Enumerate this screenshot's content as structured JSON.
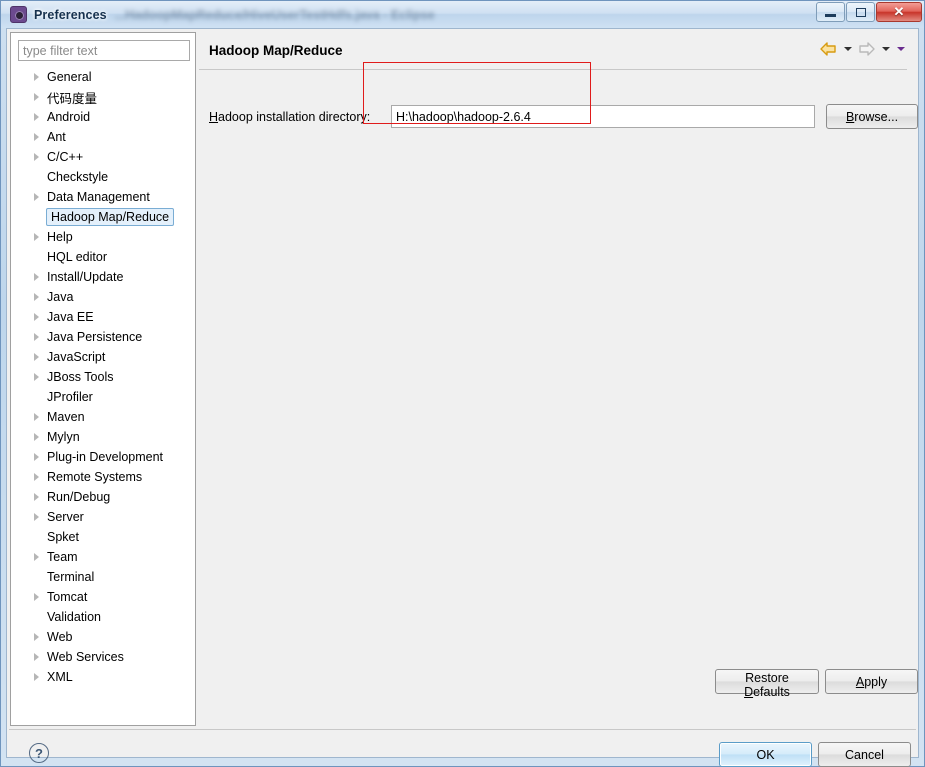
{
  "window": {
    "title": "Preferences",
    "background_title": "...HadoopMapReduce/HiveUserTestHdfs.java - Eclipse",
    "icon": "gear-icon",
    "buttons": {
      "minimize": "minimize-icon",
      "restore": "restore-icon",
      "close": "close-icon"
    }
  },
  "sidebar": {
    "filter_placeholder": "type filter text",
    "filter_value": "",
    "items": [
      {
        "label": "General",
        "expandable": true,
        "selected": false
      },
      {
        "label": "代码度量",
        "expandable": true,
        "selected": false
      },
      {
        "label": "Android",
        "expandable": true,
        "selected": false
      },
      {
        "label": "Ant",
        "expandable": true,
        "selected": false
      },
      {
        "label": "C/C++",
        "expandable": true,
        "selected": false
      },
      {
        "label": "Checkstyle",
        "expandable": false,
        "selected": false
      },
      {
        "label": "Data Management",
        "expandable": true,
        "selected": false
      },
      {
        "label": "Hadoop Map/Reduce",
        "expandable": false,
        "selected": true
      },
      {
        "label": "Help",
        "expandable": true,
        "selected": false
      },
      {
        "label": "HQL editor",
        "expandable": false,
        "selected": false
      },
      {
        "label": "Install/Update",
        "expandable": true,
        "selected": false
      },
      {
        "label": "Java",
        "expandable": true,
        "selected": false
      },
      {
        "label": "Java EE",
        "expandable": true,
        "selected": false
      },
      {
        "label": "Java Persistence",
        "expandable": true,
        "selected": false
      },
      {
        "label": "JavaScript",
        "expandable": true,
        "selected": false
      },
      {
        "label": "JBoss Tools",
        "expandable": true,
        "selected": false
      },
      {
        "label": "JProfiler",
        "expandable": false,
        "selected": false
      },
      {
        "label": "Maven",
        "expandable": true,
        "selected": false
      },
      {
        "label": "Mylyn",
        "expandable": true,
        "selected": false
      },
      {
        "label": "Plug-in Development",
        "expandable": true,
        "selected": false
      },
      {
        "label": "Remote Systems",
        "expandable": true,
        "selected": false
      },
      {
        "label": "Run/Debug",
        "expandable": true,
        "selected": false
      },
      {
        "label": "Server",
        "expandable": true,
        "selected": false
      },
      {
        "label": "Spket",
        "expandable": false,
        "selected": false
      },
      {
        "label": "Team",
        "expandable": true,
        "selected": false
      },
      {
        "label": "Terminal",
        "expandable": false,
        "selected": false
      },
      {
        "label": "Tomcat",
        "expandable": true,
        "selected": false
      },
      {
        "label": "Validation",
        "expandable": false,
        "selected": false
      },
      {
        "label": "Web",
        "expandable": true,
        "selected": false
      },
      {
        "label": "Web Services",
        "expandable": true,
        "selected": false
      },
      {
        "label": "XML",
        "expandable": true,
        "selected": false
      }
    ]
  },
  "page": {
    "title": "Hadoop Map/Reduce",
    "field_label_mnemonic": "H",
    "field_label_rest": "adoop installation directory:",
    "field_value": "H:\\hadoop\\hadoop-2.6.4",
    "browse_mnemonic": "B",
    "browse_rest": "rowse...",
    "restore_defaults_pre": "Restore ",
    "restore_defaults_mnemonic": "D",
    "restore_defaults_rest": "efaults",
    "apply_mnemonic": "A",
    "apply_rest": "pply",
    "nav": {
      "back": "back-arrow-icon",
      "back_menu": "chevron-down-icon",
      "forward": "forward-arrow-icon",
      "forward_menu": "chevron-down-icon",
      "view_menu": "chevron-down-icon"
    }
  },
  "footer": {
    "help": "?",
    "ok_label": "OK",
    "cancel_label": "Cancel"
  },
  "annotation": {
    "color": "#e01b1b",
    "shape": "rectangle"
  },
  "colors": {
    "title_bar_accent": "#bed5ec",
    "selection_fill": "#e4f0fb",
    "selection_border": "#7aadd4",
    "default_button": "#bfe0f6",
    "annotation_red": "#e01b1b",
    "back_arrow": "#e0a000"
  }
}
